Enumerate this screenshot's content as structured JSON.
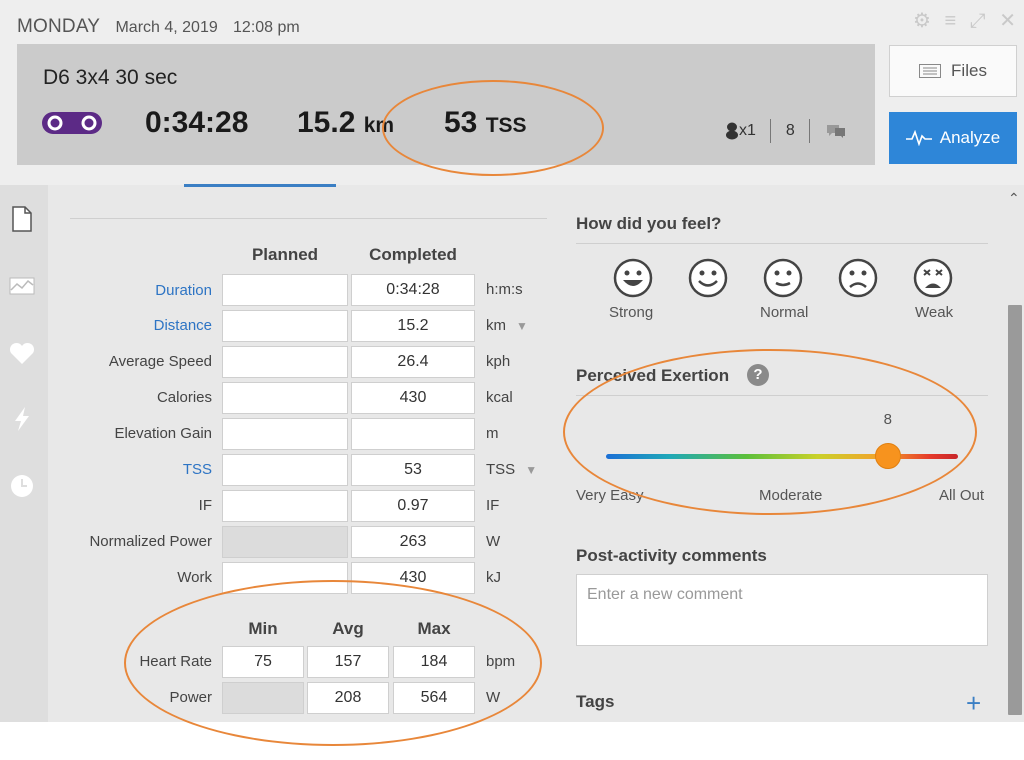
{
  "header": {
    "day": "MONDAY",
    "date": "March 4, 2019",
    "time": "12:08 pm",
    "workout_title": "D6 3x4 30 sec",
    "duration": "0:34:28",
    "distance_value": "15.2",
    "distance_unit": "km",
    "tss_value": "53",
    "tss_unit": "TSS",
    "equipment_count": "x1",
    "comments_count": "8",
    "files_label": "Files",
    "analyze_label": "Analyze"
  },
  "form": {
    "planned_header": "Planned",
    "completed_header": "Completed",
    "rows": [
      {
        "label": "Duration",
        "planned": "",
        "completed": "0:34:28",
        "unit": "h:m:s"
      },
      {
        "label": "Distance",
        "planned": "",
        "completed": "15.2",
        "unit": "km"
      },
      {
        "label": "Average Speed",
        "planned": "",
        "completed": "26.4",
        "unit": "kph"
      },
      {
        "label": "Calories",
        "planned": "",
        "completed": "430",
        "unit": "kcal"
      },
      {
        "label": "Elevation Gain",
        "planned": "",
        "completed": "",
        "unit": "m"
      },
      {
        "label": "TSS",
        "planned": "",
        "completed": "53",
        "unit": "TSS"
      },
      {
        "label": "IF",
        "planned": "",
        "completed": "0.97",
        "unit": "IF"
      },
      {
        "label": "Normalized Power",
        "planned": "",
        "completed": "263",
        "unit": "W"
      },
      {
        "label": "Work",
        "planned": "",
        "completed": "430",
        "unit": "kJ"
      }
    ],
    "min_header": "Min",
    "avg_header": "Avg",
    "max_header": "Max",
    "stat_rows": [
      {
        "label": "Heart Rate",
        "min": "75",
        "avg": "157",
        "max": "184",
        "unit": "bpm"
      },
      {
        "label": "Power",
        "min": "",
        "avg": "208",
        "max": "564",
        "unit": "W"
      }
    ]
  },
  "feel": {
    "title": "How did you feel?",
    "labels": {
      "strong": "Strong",
      "normal": "Normal",
      "weak": "Weak"
    }
  },
  "exertion": {
    "title": "Perceived Exertion",
    "help": "?",
    "value": "8",
    "level": 8,
    "max": 10,
    "labels": {
      "low": "Very Easy",
      "mid": "Moderate",
      "high": "All Out"
    }
  },
  "comments": {
    "title": "Post-activity comments",
    "placeholder": "Enter a new comment"
  },
  "tags": {
    "title": "Tags",
    "add": "+"
  },
  "colors": {
    "accent": "#2e86d8",
    "slider_thumb": "#f7931e",
    "annotation": "#e8873a"
  }
}
